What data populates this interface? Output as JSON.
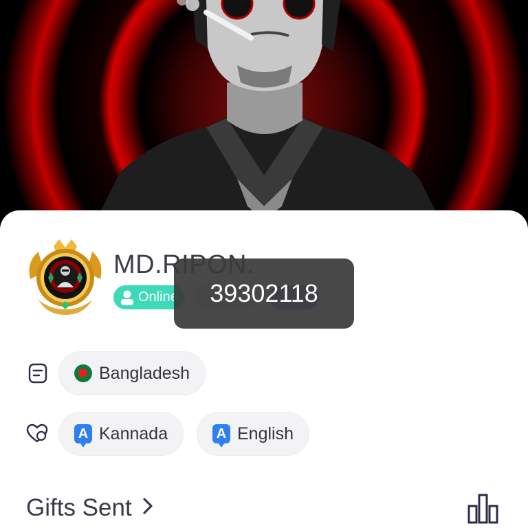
{
  "profile": {
    "username": "MD.RIPON.",
    "status_label": "Online"
  },
  "toast": {
    "text": "39302118"
  },
  "info": {
    "country": "Bangladesh",
    "languages": [
      "Kannada",
      "English"
    ],
    "lang_icon_glyph": "A"
  },
  "sections": {
    "gifts_sent": "Gifts Sent"
  },
  "icons": {
    "info_row": "document-icon",
    "language_row": "heart-chat-icon",
    "stats": "bar-chart-icon",
    "chevron": "chevron-right-icon"
  },
  "colors": {
    "online_badge": "#3ed9b8",
    "cover_red": "#d40000",
    "toast_bg": "#3a3a3a",
    "lang_icon": "#2f7ff0"
  }
}
